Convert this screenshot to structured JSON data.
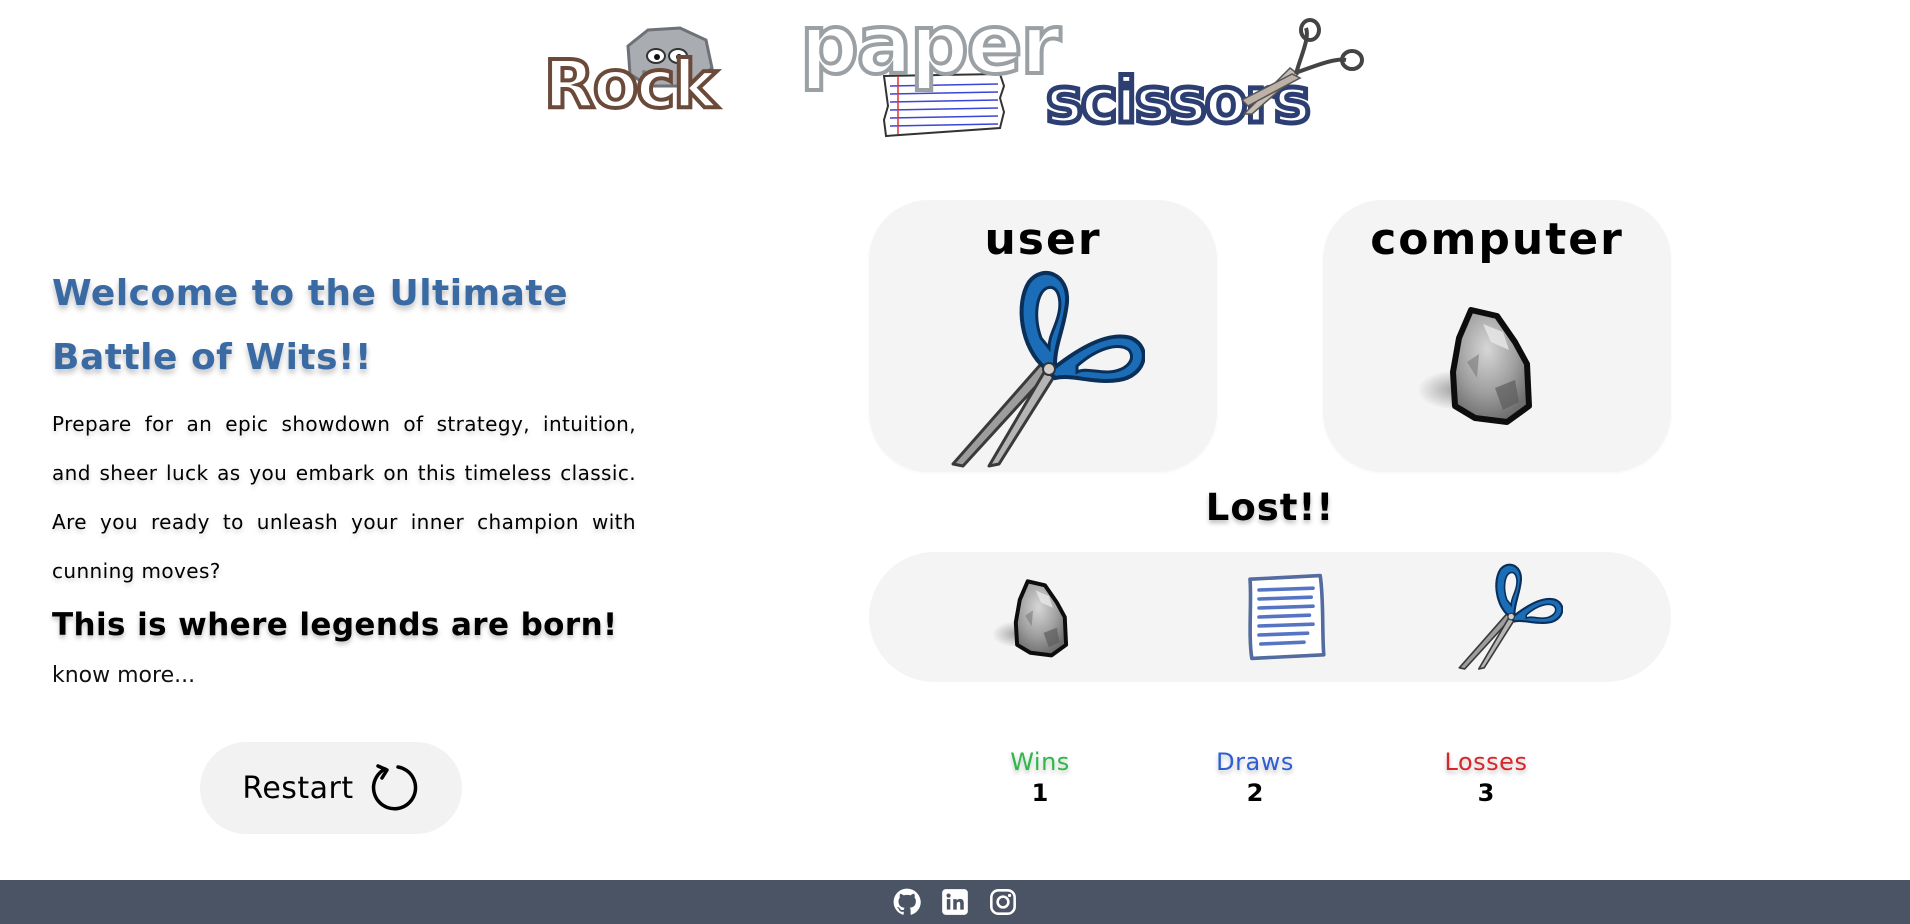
{
  "logo": {
    "rock": "Rock",
    "paper": "paper",
    "scissors": "scissors"
  },
  "intro": {
    "heading": "Welcome to the Ultimate Battle of Wits!!",
    "body": "Prepare for an epic showdown of strategy, intuition, and sheer luck as you embark on this timeless classic. Are you ready to unleash your inner champion with cunning moves?",
    "tagline": "This is where legends are born!",
    "know_more": "know more..."
  },
  "restart": {
    "label": "Restart",
    "icon": "restart-icon"
  },
  "game": {
    "user": {
      "title": "user",
      "choice": "scissors"
    },
    "computer": {
      "title": "computer",
      "choice": "rock"
    },
    "result": "Lost!!",
    "choices": [
      {
        "name": "rock",
        "icon": "rock-icon"
      },
      {
        "name": "paper",
        "icon": "paper-icon"
      },
      {
        "name": "scissors",
        "icon": "scissors-icon"
      }
    ]
  },
  "score": {
    "wins": {
      "label": "Wins",
      "value": "1",
      "color": "#2fb84a"
    },
    "draws": {
      "label": "Draws",
      "value": "2",
      "color": "#2e5ed6"
    },
    "losses": {
      "label": "Losses",
      "value": "3",
      "color": "#d9262a"
    }
  },
  "footer": {
    "links": [
      {
        "icon": "github-icon"
      },
      {
        "icon": "linkedin-icon"
      },
      {
        "icon": "instagram-icon"
      }
    ],
    "background": "#4a5464"
  }
}
